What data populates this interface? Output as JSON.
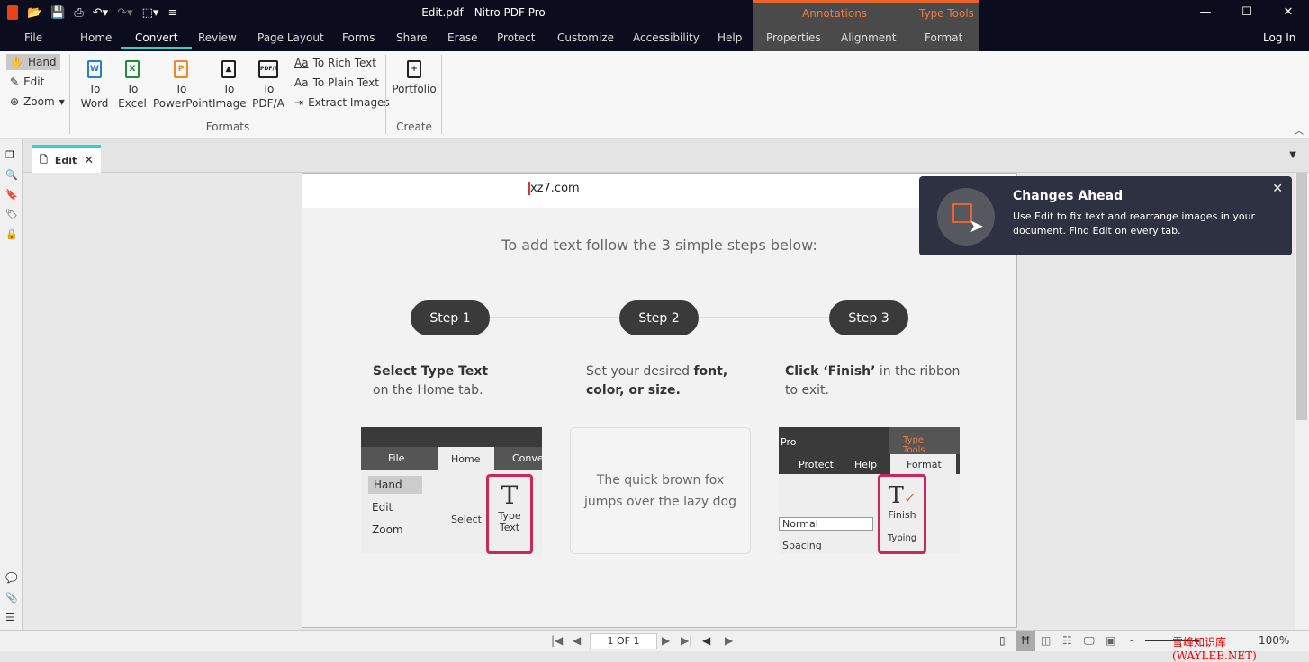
{
  "app": {
    "title": "Edit.pdf - Nitro PDF Pro",
    "login": "Log In"
  },
  "context_tabs": {
    "annotations": "Annotations",
    "type_tools": "Type Tools"
  },
  "menu": [
    "File",
    "Home",
    "Convert",
    "Review",
    "Page Layout",
    "Forms",
    "Share",
    "Erase",
    "Protect",
    "Customize",
    "Accessibility",
    "Help",
    "Properties",
    "Alignment",
    "Format"
  ],
  "active_tab": "Convert",
  "ribbon": {
    "hand": "Hand",
    "edit": "Edit",
    "zoom": "Zoom",
    "to_word": "To Word",
    "to_excel": "To Excel",
    "to_powerpoint": "To PowerPoint",
    "to_image": "To Image",
    "to_pdfa": "To PDF/A",
    "to_rich_text": "To Rich Text",
    "to_plain_text": "To Plain Text",
    "extract_images": "Extract Images",
    "formats_group": "Formats",
    "portfolio": "Portfolio",
    "create_group": "Create"
  },
  "doc_tab": {
    "label": "Edit"
  },
  "page": {
    "header_text": "xz7.com",
    "instruction": "To add text follow the 3 simple steps below:",
    "steps": [
      {
        "label": "Step 1",
        "bold": "Select Type Text",
        "rest": "on the Home tab."
      },
      {
        "label": "Step 2",
        "pre": "Set your desired ",
        "bold1": "font,",
        "bold2": "color, or size."
      },
      {
        "label": "Step 3",
        "bold": "Click ‘Finish’",
        "rest1": " in the ribbon",
        "rest2": "to exit."
      }
    ],
    "sample_text": [
      "The quick brown fox",
      "jumps over the lazy dog"
    ],
    "thumb1": {
      "file": "File",
      "home": "Home",
      "conv": "Conve",
      "hand": "Hand",
      "edit": "Edit",
      "zoom": "Zoom",
      "select": "Select",
      "type_text": "Type Text"
    },
    "thumb3": {
      "pro": "Pro",
      "type_tools": "Type Tools",
      "protect": "Protect",
      "help": "Help",
      "format": "Format",
      "normal": "Normal",
      "spacing": "Spacing",
      "finish": "Finish",
      "typing": "Typing"
    }
  },
  "toast": {
    "title": "Changes Ahead",
    "body": "Use Edit to fix text and rearrange images in your document. Find Edit on every tab."
  },
  "status": {
    "page": "1 OF 1",
    "zoom": "100%",
    "watermark": "雪峰知识库 (WAYLEE.NET)"
  },
  "colors": {
    "accent": "#2dd4c8",
    "brand": "#e8411c",
    "titlebar": "#0b0d1e",
    "context": "#e8642c"
  }
}
